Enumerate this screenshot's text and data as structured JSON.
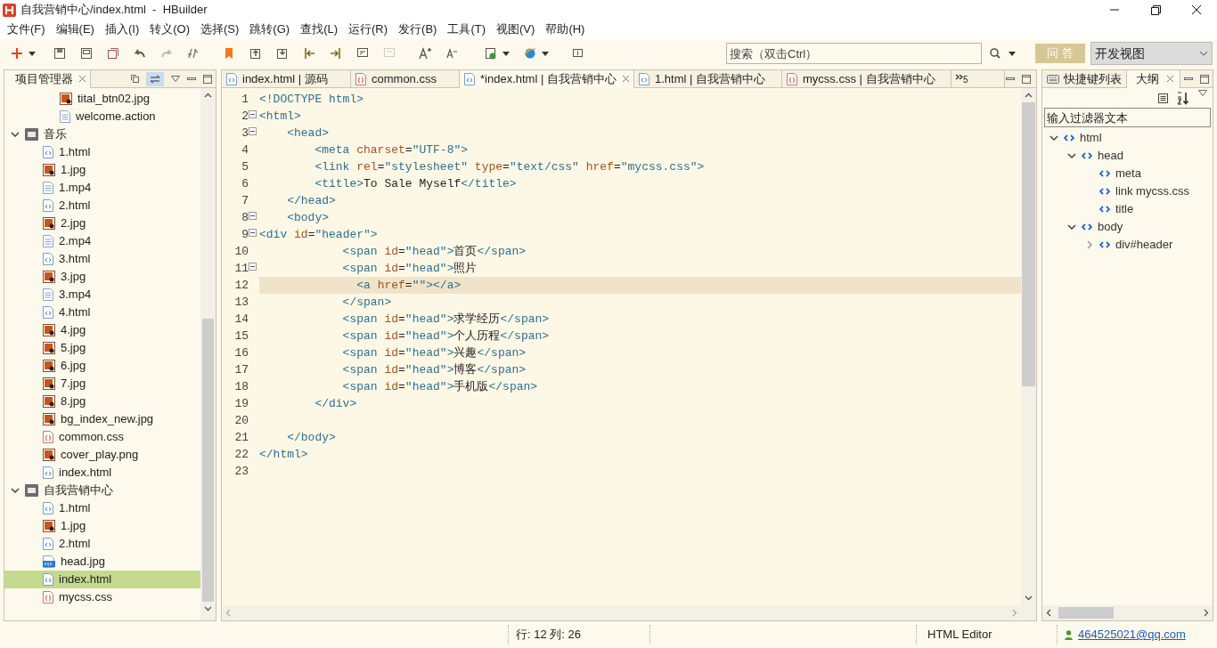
{
  "window": {
    "title": "自我营销中心/index.html  -  HBuilder"
  },
  "menu": [
    "文件(F)",
    "编辑(E)",
    "插入(I)",
    "转义(O)",
    "选择(S)",
    "跳转(G)",
    "查找(L)",
    "运行(R)",
    "发行(B)",
    "工具(T)",
    "视图(V)",
    "帮助(H)"
  ],
  "toolbar": {
    "search": {
      "placeholder": "搜索（双击Ctrl）"
    },
    "qa_button": "问 答",
    "perspective": "开发视图"
  },
  "project_panel": {
    "tab": {
      "label": "项目管理器",
      "selected": true
    },
    "tree": {
      "hidden_parent_children": [
        {
          "label": "tital_btn02.jpg",
          "kind": "image",
          "selected": false
        },
        {
          "label": "welcome.action",
          "kind": "doc",
          "selected": false
        }
      ],
      "projects": [
        {
          "label": "音乐",
          "expanded": true,
          "children": [
            {
              "label": "1.html",
              "kind": "html",
              "selected": false
            },
            {
              "label": "1.jpg",
              "kind": "image",
              "selected": false
            },
            {
              "label": "1.mp4",
              "kind": "doc",
              "selected": false
            },
            {
              "label": "2.html",
              "kind": "html",
              "selected": false
            },
            {
              "label": "2.jpg",
              "kind": "image",
              "selected": false
            },
            {
              "label": "2.mp4",
              "kind": "doc",
              "selected": false
            },
            {
              "label": "3.html",
              "kind": "html",
              "selected": false
            },
            {
              "label": "3.jpg",
              "kind": "image",
              "selected": false
            },
            {
              "label": "3.mp4",
              "kind": "doc",
              "selected": false
            },
            {
              "label": "4.html",
              "kind": "html",
              "selected": false
            },
            {
              "label": "4.jpg",
              "kind": "image",
              "selected": false
            },
            {
              "label": "5.jpg",
              "kind": "image",
              "selected": false
            },
            {
              "label": "6.jpg",
              "kind": "image",
              "selected": false
            },
            {
              "label": "7.jpg",
              "kind": "image",
              "selected": false
            },
            {
              "label": "8.jpg",
              "kind": "image",
              "selected": false
            },
            {
              "label": "bg_index_new.jpg",
              "kind": "image",
              "selected": false
            },
            {
              "label": "common.css",
              "kind": "css",
              "selected": false
            },
            {
              "label": "cover_play.png",
              "kind": "image",
              "selected": false
            },
            {
              "label": "index.html",
              "kind": "html",
              "selected": false
            }
          ]
        },
        {
          "label": "自我营销中心",
          "expanded": true,
          "children": [
            {
              "label": "1.html",
              "kind": "html",
              "selected": false
            },
            {
              "label": "1.jpg",
              "kind": "image",
              "selected": false
            },
            {
              "label": "2.html",
              "kind": "html",
              "selected": false
            },
            {
              "label": "head.jpg",
              "kind": "jpg",
              "selected": false
            },
            {
              "label": "index.html",
              "kind": "html",
              "selected": true
            },
            {
              "label": "mycss.css",
              "kind": "css",
              "selected": false
            }
          ]
        }
      ]
    }
  },
  "editor": {
    "tabs": [
      {
        "label": "index.html | 源码",
        "kind": "html",
        "selected": false
      },
      {
        "label": "common.css",
        "kind": "css",
        "selected": false
      },
      {
        "label": "*index.html | 自我营销中心",
        "kind": "html",
        "selected": true
      },
      {
        "label": "1.html | 自我营销中心",
        "kind": "html",
        "selected": false
      },
      {
        "label": "mycss.css | 自我营销中心",
        "kind": "css",
        "selected": false
      }
    ],
    "overflow_count": "5",
    "lines": [
      {
        "number": "1",
        "foldable": false,
        "current": false,
        "tokens": [
          {
            "kind": "tag",
            "text": "<!DOCTYPE html>"
          }
        ]
      },
      {
        "number": "2",
        "foldable": true,
        "current": false,
        "tokens": [
          {
            "kind": "tag",
            "text": "<html>"
          }
        ]
      },
      {
        "number": "3",
        "foldable": true,
        "current": false,
        "tokens": [
          {
            "kind": "tag",
            "text": "    <head>"
          }
        ]
      },
      {
        "number": "4",
        "foldable": false,
        "current": false,
        "tokens": [
          {
            "kind": "tag",
            "text": "        <meta "
          },
          {
            "kind": "attr",
            "text": "charset"
          },
          {
            "kind": "plain",
            "text": "="
          },
          {
            "kind": "value",
            "text": "\"UTF-8\""
          },
          {
            "kind": "tag",
            "text": ">"
          }
        ]
      },
      {
        "number": "5",
        "foldable": false,
        "current": false,
        "tokens": [
          {
            "kind": "tag",
            "text": "        <link "
          },
          {
            "kind": "attr",
            "text": "rel"
          },
          {
            "kind": "plain",
            "text": "="
          },
          {
            "kind": "value",
            "text": "\"stylesheet\" "
          },
          {
            "kind": "attr",
            "text": "type"
          },
          {
            "kind": "plain",
            "text": "="
          },
          {
            "kind": "value",
            "text": "\"text/css\" "
          },
          {
            "kind": "attr",
            "text": "href"
          },
          {
            "kind": "plain",
            "text": "="
          },
          {
            "kind": "value",
            "text": "\"mycss.css\""
          },
          {
            "kind": "tag",
            "text": ">"
          }
        ]
      },
      {
        "number": "6",
        "foldable": false,
        "current": false,
        "tokens": [
          {
            "kind": "tag",
            "text": "        <title>"
          },
          {
            "kind": "plain",
            "text": "To Sale Myself"
          },
          {
            "kind": "tag",
            "text": "</title>"
          }
        ]
      },
      {
        "number": "7",
        "foldable": false,
        "current": false,
        "tokens": [
          {
            "kind": "tag",
            "text": "    </head>"
          }
        ]
      },
      {
        "number": "8",
        "foldable": true,
        "current": false,
        "tokens": [
          {
            "kind": "tag",
            "text": "    <body>"
          }
        ]
      },
      {
        "number": "9",
        "foldable": true,
        "current": false,
        "tokens": [
          {
            "kind": "tag",
            "text": "<div "
          },
          {
            "kind": "attr",
            "text": "id"
          },
          {
            "kind": "plain",
            "text": "="
          },
          {
            "kind": "value",
            "text": "\"header\""
          },
          {
            "kind": "tag",
            "text": ">"
          }
        ]
      },
      {
        "number": "10",
        "foldable": false,
        "current": false,
        "tokens": [
          {
            "kind": "tag",
            "text": "            <span "
          },
          {
            "kind": "attr",
            "text": "id"
          },
          {
            "kind": "plain",
            "text": "="
          },
          {
            "kind": "value",
            "text": "\"head\""
          },
          {
            "kind": "tag",
            "text": ">"
          },
          {
            "kind": "plain",
            "text": "首页"
          },
          {
            "kind": "tag",
            "text": "</span>"
          }
        ]
      },
      {
        "number": "11",
        "foldable": true,
        "current": false,
        "tokens": [
          {
            "kind": "tag",
            "text": "            <span "
          },
          {
            "kind": "attr",
            "text": "id"
          },
          {
            "kind": "plain",
            "text": "="
          },
          {
            "kind": "value",
            "text": "\"head\""
          },
          {
            "kind": "tag",
            "text": ">"
          },
          {
            "kind": "plain",
            "text": "照片"
          }
        ]
      },
      {
        "number": "12",
        "foldable": false,
        "current": true,
        "tokens": [
          {
            "kind": "tag",
            "text": "              <a "
          },
          {
            "kind": "attr",
            "text": "href"
          },
          {
            "kind": "plain",
            "text": "="
          },
          {
            "kind": "value",
            "text": "\"\""
          },
          {
            "kind": "tag",
            "text": "></a>"
          }
        ]
      },
      {
        "number": "13",
        "foldable": false,
        "current": false,
        "tokens": [
          {
            "kind": "tag",
            "text": "            </span>"
          }
        ]
      },
      {
        "number": "14",
        "foldable": false,
        "current": false,
        "tokens": [
          {
            "kind": "tag",
            "text": "            <span "
          },
          {
            "kind": "attr",
            "text": "id"
          },
          {
            "kind": "plain",
            "text": "="
          },
          {
            "kind": "value",
            "text": "\"head\""
          },
          {
            "kind": "tag",
            "text": ">"
          },
          {
            "kind": "plain",
            "text": "求学经历"
          },
          {
            "kind": "tag",
            "text": "</span>"
          }
        ]
      },
      {
        "number": "15",
        "foldable": false,
        "current": false,
        "tokens": [
          {
            "kind": "tag",
            "text": "            <span "
          },
          {
            "kind": "attr",
            "text": "id"
          },
          {
            "kind": "plain",
            "text": "="
          },
          {
            "kind": "value",
            "text": "\"head\""
          },
          {
            "kind": "tag",
            "text": ">"
          },
          {
            "kind": "plain",
            "text": "个人历程"
          },
          {
            "kind": "tag",
            "text": "</span>"
          }
        ]
      },
      {
        "number": "16",
        "foldable": false,
        "current": false,
        "tokens": [
          {
            "kind": "tag",
            "text": "            <span "
          },
          {
            "kind": "attr",
            "text": "id"
          },
          {
            "kind": "plain",
            "text": "="
          },
          {
            "kind": "value",
            "text": "\"head\""
          },
          {
            "kind": "tag",
            "text": ">"
          },
          {
            "kind": "plain",
            "text": "兴趣"
          },
          {
            "kind": "tag",
            "text": "</span>"
          }
        ]
      },
      {
        "number": "17",
        "foldable": false,
        "current": false,
        "tokens": [
          {
            "kind": "tag",
            "text": "            <span "
          },
          {
            "kind": "attr",
            "text": "id"
          },
          {
            "kind": "plain",
            "text": "="
          },
          {
            "kind": "value",
            "text": "\"head\""
          },
          {
            "kind": "tag",
            "text": ">"
          },
          {
            "kind": "plain",
            "text": "博客"
          },
          {
            "kind": "tag",
            "text": "</span>"
          }
        ]
      },
      {
        "number": "18",
        "foldable": false,
        "current": false,
        "tokens": [
          {
            "kind": "tag",
            "text": "            <span "
          },
          {
            "kind": "attr",
            "text": "id"
          },
          {
            "kind": "plain",
            "text": "="
          },
          {
            "kind": "value",
            "text": "\"head\""
          },
          {
            "kind": "tag",
            "text": ">"
          },
          {
            "kind": "plain",
            "text": "手机版"
          },
          {
            "kind": "tag",
            "text": "</span>"
          }
        ]
      },
      {
        "number": "19",
        "foldable": false,
        "current": false,
        "tokens": [
          {
            "kind": "tag",
            "text": "        </div>"
          }
        ]
      },
      {
        "number": "20",
        "foldable": false,
        "current": false
      },
      {
        "number": "21",
        "foldable": false,
        "current": false,
        "tokens": [
          {
            "kind": "tag",
            "text": "    </body>"
          }
        ]
      },
      {
        "number": "22",
        "foldable": false,
        "current": false,
        "tokens": [
          {
            "kind": "tag",
            "text": "</html>"
          }
        ]
      },
      {
        "number": "23",
        "foldable": false,
        "current": false
      }
    ]
  },
  "outline_panel": {
    "tabs": [
      {
        "label": "快捷键列表",
        "selected": false
      },
      {
        "label": "大纲",
        "selected": true
      }
    ],
    "filter": {
      "placeholder": "输入过滤器文本"
    },
    "tree": [
      {
        "label": "html",
        "expanded": true,
        "children": [
          {
            "label": "head",
            "expanded": true,
            "children": [
              {
                "label": "meta"
              },
              {
                "label": "link mycss.css"
              },
              {
                "label": "title"
              }
            ]
          },
          {
            "label": "body",
            "expanded": true,
            "children": [
              {
                "label": "div#header",
                "expanded": false
              }
            ]
          }
        ]
      }
    ]
  },
  "status_bar": {
    "position": "行: 12 列: 26",
    "editor_type": "HTML Editor",
    "account": "464525021@qq.com"
  }
}
